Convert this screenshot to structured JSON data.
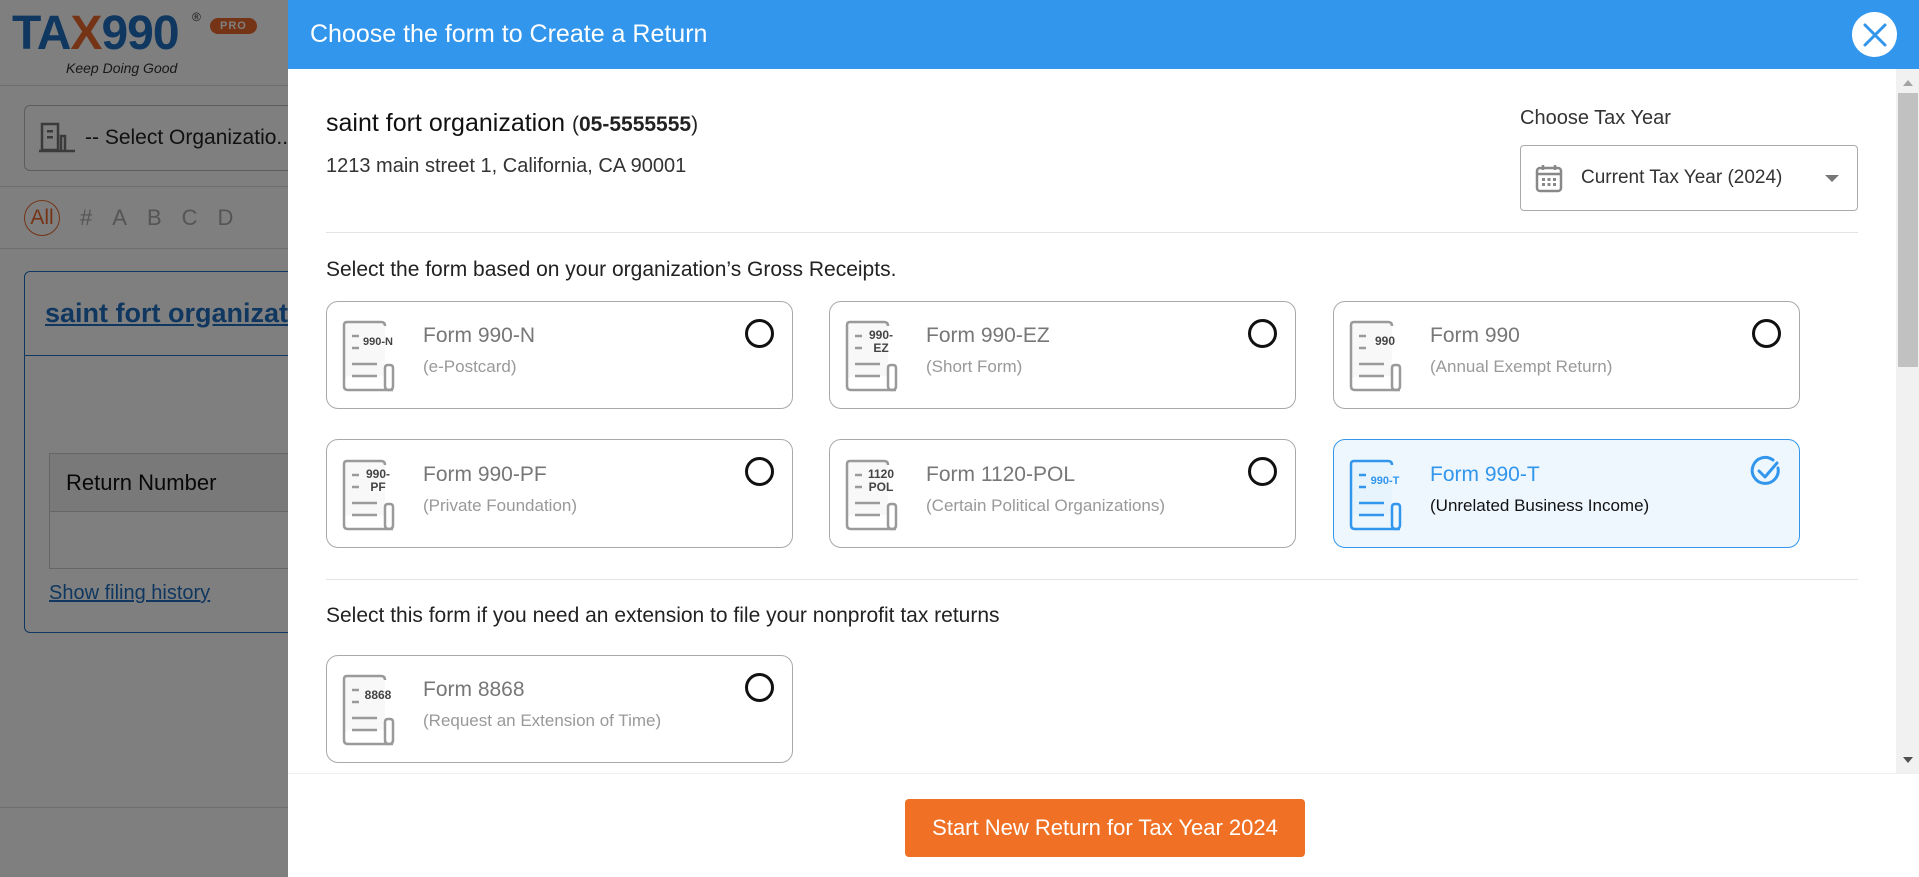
{
  "background": {
    "logo": {
      "text_a": "TA",
      "text_x": "X",
      "text_b": "990",
      "registered": "®",
      "badge": "PRO",
      "tagline": "Keep Doing Good"
    },
    "org_select_placeholder": "-- Select Organizatio...",
    "alphabet": [
      "All",
      "#",
      "A",
      "B",
      "C",
      "D"
    ],
    "org_card": {
      "name": "saint fort organization",
      "table_header": "Return Number",
      "filing_history_link": "Show filing history"
    }
  },
  "modal": {
    "title": "Choose the form to Create a Return",
    "organization": {
      "name": "saint fort organization",
      "ein": "05-5555555",
      "address": "1213 main street 1, California, CA 90001"
    },
    "tax_year": {
      "label": "Choose Tax Year",
      "selected": "Current Tax Year (2024)"
    },
    "gross_receipts_prompt": "Select the form based on your organization’s Gross Receipts.",
    "forms": [
      {
        "code": "990-N",
        "code_l1": "990-N",
        "code_l2": "",
        "title": "Form 990-N",
        "subtitle": "(e-Postcard)",
        "selected": false
      },
      {
        "code": "990-EZ",
        "code_l1": "990-",
        "code_l2": "EZ",
        "title": "Form 990-EZ",
        "subtitle": "(Short Form)",
        "selected": false
      },
      {
        "code": "990",
        "code_l1": "990",
        "code_l2": "",
        "title": "Form 990",
        "subtitle": "(Annual Exempt Return)",
        "selected": false
      },
      {
        "code": "990-PF",
        "code_l1": "990-",
        "code_l2": "PF",
        "title": "Form 990-PF",
        "subtitle": "(Private Foundation)",
        "selected": false
      },
      {
        "code": "1120-POL",
        "code_l1": "1120",
        "code_l2": "POL",
        "title": "Form 1120-POL",
        "subtitle": "(Certain Political Organizations)",
        "selected": false
      },
      {
        "code": "990-T",
        "code_l1": "990-T",
        "code_l2": "",
        "title": "Form 990-T",
        "subtitle": "(Unrelated Business Income)",
        "selected": true
      }
    ],
    "extension_prompt": "Select this form if you need an extension to file your nonprofit tax returns",
    "extension_form": {
      "code": "8868",
      "code_l1": "8868",
      "code_l2": "",
      "title": "Form 8868",
      "subtitle": "(Request an Extension of Time)",
      "selected": false
    },
    "start_button": "Start New Return for Tax Year 2024"
  },
  "colors": {
    "header_blue": "#3296ed",
    "accent_orange": "#f07125",
    "selected_bg": "#eef7fe",
    "link_blue": "#1f6fbf"
  }
}
